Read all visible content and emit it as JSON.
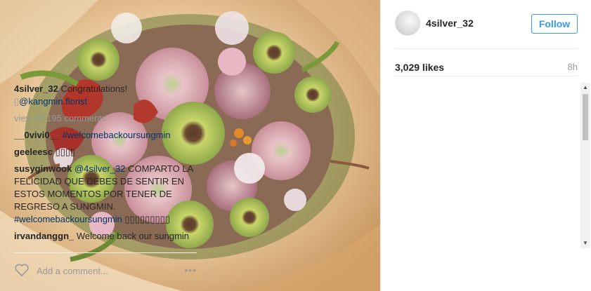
{
  "post": {
    "username": "4silver_32",
    "follow_label": "Follow",
    "likes": "3,029 likes",
    "time_ago": "8h"
  },
  "caption": {
    "username": "4silver_32",
    "text": "Congratulations!",
    "mention_prefix": "▯",
    "mention": "@kangmin.florist"
  },
  "view_all": "view all 195 comments",
  "comments": [
    {
      "username": "__0vivi0__",
      "text": "",
      "tag": "#welcomebackoursungmin"
    },
    {
      "username": "geeleesc",
      "text": "▯▯▯▯"
    },
    {
      "username": "susyginwook",
      "mention": "@4silver_32",
      "text": "COMPARTO LA FELICIDAD QUE DEBES DE SENTIR EN ESTOS MOMENTOS POR TENER DE REGRESO A SUNGMIN.",
      "tag": "#welcomebackoursungmin",
      "tail": "▯▯▯▯▯▯▯▯▯"
    },
    {
      "username": "irvandanggn_",
      "text": "Welcome back our sungmin"
    }
  ],
  "footer": {
    "comment_placeholder": "Add a comment...",
    "more": "•••"
  },
  "icons": {
    "like": "heart-icon",
    "more": "more-options-icon"
  },
  "colors": {
    "link_blue": "#3897f0",
    "mention_blue": "#003569",
    "muted": "#999999"
  }
}
